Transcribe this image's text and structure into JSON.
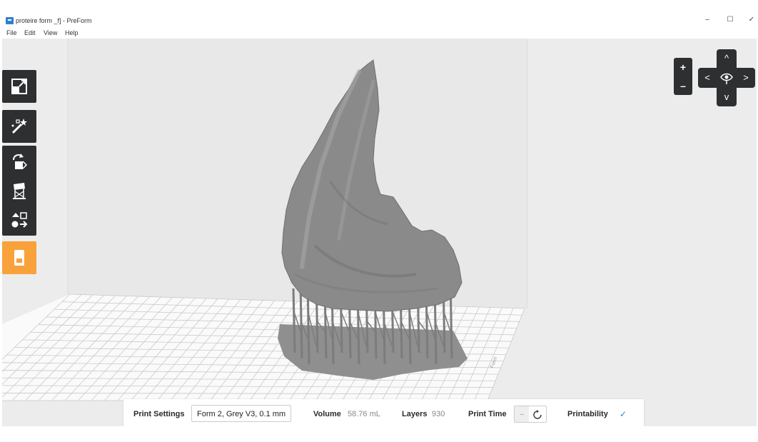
{
  "window": {
    "title": "proteire form _f] - PreForm",
    "controls": {
      "minimize": "–",
      "maximize": "☐",
      "close": "✓"
    }
  },
  "menu": [
    "File",
    "Edit",
    "View",
    "Help"
  ],
  "toolbar": {
    "icons": [
      "layout-icon",
      "magic-wand-icon",
      "orient-icon",
      "supports-icon",
      "layout-arrange-icon",
      "job-icon"
    ]
  },
  "zoom": {
    "in": "+",
    "out": "–"
  },
  "nav": {
    "up": "^",
    "down": "v",
    "left": "<",
    "right": ">"
  },
  "bottombar": {
    "print_settings_label": "Print Settings",
    "print_settings_value": "Form 2, Grey V3, 0.1 mm",
    "volume_label": "Volume",
    "volume_value": "58.76 mL",
    "layers_label": "Layers",
    "layers_value": "930",
    "print_time_label": "Print Time",
    "print_time_value": "--",
    "printability_label": "Printability",
    "printability_icon": "check-icon"
  },
  "colors": {
    "accent": "#f9a13b",
    "toolbar": "#2e2f31",
    "model": "#8a8a8a",
    "check": "#2f88d8"
  }
}
